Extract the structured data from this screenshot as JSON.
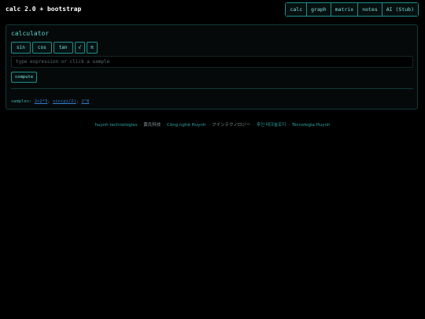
{
  "navbar": {
    "brand": "calc 2.0 + bootstrap",
    "items": [
      "calc",
      "graph",
      "matrix",
      "notes",
      "AI (Stub)"
    ]
  },
  "calculator": {
    "title": "calculator",
    "functions": [
      "sin",
      "cos",
      "tan",
      "√",
      "π"
    ],
    "input_placeholder": "type expression or click a sample",
    "compute_label": "compute",
    "samples_label": "samples:",
    "samples": [
      "2+2*3",
      "sin(pi/2)",
      "2^8"
    ]
  },
  "footer": {
    "items": [
      "huynh technologies",
      "黄氏科技",
      "Công nghệ Huynh",
      "フインテクノロジー",
      "후인 테크놀로지",
      "Tecnologia Huynh"
    ],
    "separator": "·"
  },
  "colors": {
    "background": "#000000",
    "accent": "#1f8f8f",
    "link": "#2f7fd0"
  }
}
